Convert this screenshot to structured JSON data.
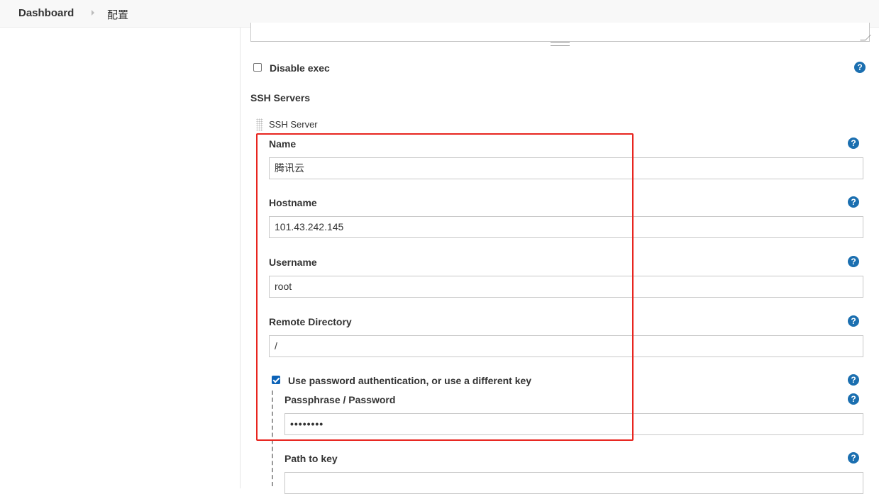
{
  "breadcrumb": {
    "dashboard": "Dashboard",
    "current": "配置"
  },
  "disable_exec": {
    "label": "Disable exec",
    "checked": false
  },
  "ssh_servers": {
    "section_title": "SSH Servers",
    "server_title": "SSH Server",
    "name": {
      "label": "Name",
      "value": "腾讯云"
    },
    "hostname": {
      "label": "Hostname",
      "value": "101.43.242.145"
    },
    "username": {
      "label": "Username",
      "value": "root"
    },
    "remote_directory": {
      "label": "Remote Directory",
      "value": "/"
    },
    "use_password": {
      "label": "Use password authentication, or use a different key",
      "checked": true
    },
    "passphrase": {
      "label": "Passphrase / Password",
      "value": "••••••••"
    },
    "path_to_key": {
      "label": "Path to key",
      "value": ""
    }
  },
  "help_glyph": "?",
  "colors": {
    "accent": "#1b6fb0",
    "highlight": "#e8251f"
  }
}
